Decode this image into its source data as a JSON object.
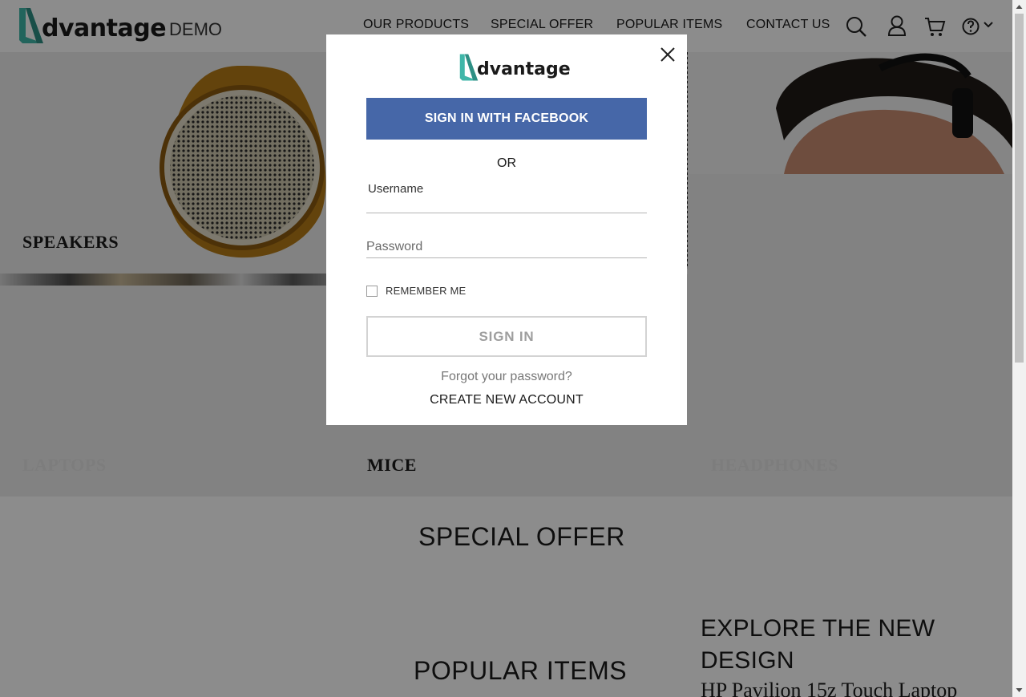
{
  "header": {
    "logo_text": "dvantage",
    "logo_demo": "DEMO",
    "nav": [
      "OUR PRODUCTS",
      "SPECIAL OFFER",
      "POPULAR ITEMS",
      "CONTACT US"
    ]
  },
  "categories": {
    "speakers": "SPEAKERS",
    "laptops": "LAPTOPS",
    "mice": "MICE",
    "headphones": "HEADPHONES"
  },
  "sections": {
    "special_offer": "SPECIAL OFFER",
    "popular_items": "POPULAR ITEMS",
    "explore": "EXPLORE THE NEW DESIGN",
    "product": "HP Pavilion 15z Touch Laptop"
  },
  "login_modal": {
    "logo_text": "dvantage",
    "facebook_button": "SIGN IN WITH FACEBOOK",
    "or": "OR",
    "username_label": "Username",
    "password_placeholder": "Password",
    "remember_me": "REMEMBER ME",
    "sign_in_button": "SIGN IN",
    "forgot_password": "Forgot your password?",
    "create_account": "CREATE NEW ACCOUNT"
  },
  "icons": [
    "search-icon",
    "user-icon",
    "cart-icon",
    "help-icon",
    "chevron-down-icon",
    "close-icon"
  ],
  "colors": {
    "brand_teal": "#3fb6a8",
    "facebook_blue": "#4667a8"
  }
}
